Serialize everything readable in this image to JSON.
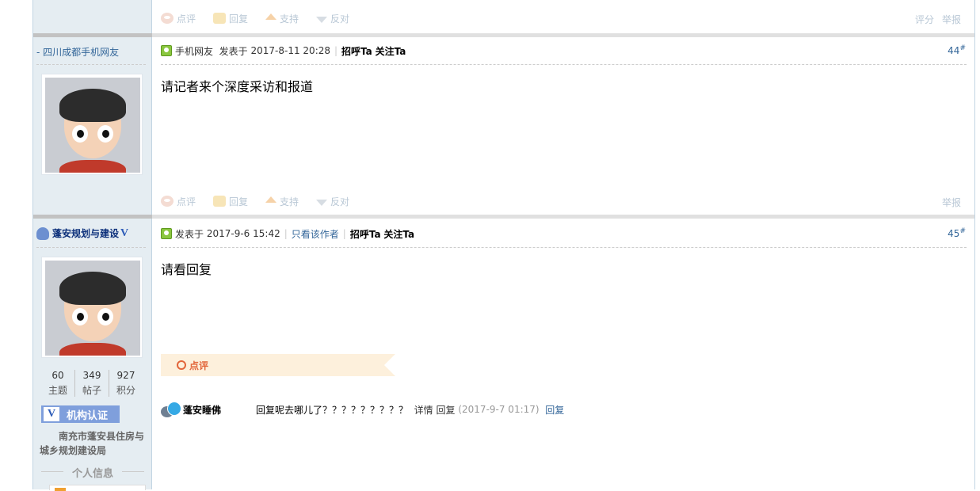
{
  "post_top": {
    "actions": [
      "点评",
      "回复",
      "支持",
      "反对"
    ],
    "right_links": [
      "评分",
      "举报"
    ]
  },
  "post44": {
    "author": "- 四川成都手机网友",
    "header": {
      "source": "手机网友",
      "posted_label": "发表于",
      "date": "2017-8-11 20:28",
      "greet": "招呼Ta",
      "follow": "关注Ta"
    },
    "floor": "44",
    "floor_sup": "#",
    "message": "请记者来个深度采访和报道",
    "actions": [
      "点评",
      "回复",
      "支持",
      "反对"
    ],
    "right_links": [
      "举报"
    ]
  },
  "post45": {
    "author": "蓬安规划与建设",
    "verified_mark": "V",
    "header": {
      "posted_label": "发表于",
      "date": "2017-9-6 15:42",
      "only_author": "只看该作者",
      "greet": "招呼Ta",
      "follow": "关注Ta"
    },
    "floor": "45",
    "floor_sup": "#",
    "message": "请看回复",
    "stats": [
      {
        "num": "60",
        "label": "主题"
      },
      {
        "num": "349",
        "label": "帖子"
      },
      {
        "num": "927",
        "label": "积分"
      }
    ],
    "verify_badge": {
      "mark": "V",
      "label": "机构认证"
    },
    "org_name": "南充市蓬安县住房与城乡规划建设局",
    "personal_info": "个人信息",
    "comment_section_label": "点评",
    "comment": {
      "user": "蓬安睡佛",
      "text": "回复呢去哪儿了？？？？？？？？？",
      "detail": "详情",
      "reply": "回复",
      "time": "(2017-9-7 01:17)",
      "reply_link": "回复"
    }
  },
  "colors": {
    "link": "#336699",
    "sidebar": "#e5edf2",
    "accent_orange": "#e2653a"
  }
}
